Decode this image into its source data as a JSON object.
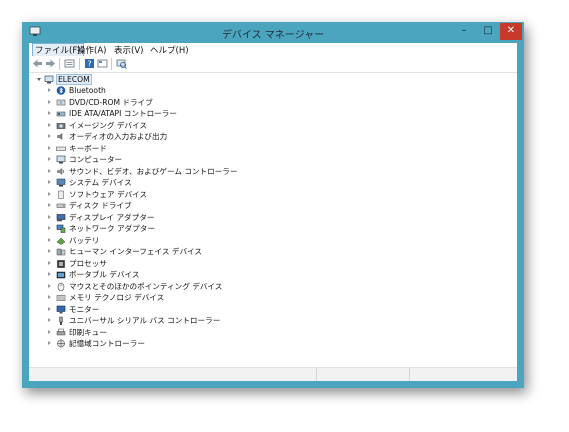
{
  "window": {
    "title": "デバイス マネージャー",
    "minimize_glyph": "–",
    "maximize_glyph": "□",
    "close_glyph": "✕"
  },
  "menu": [
    {
      "label": "ファイル(F)",
      "active": true
    },
    {
      "label": "操作(A)"
    },
    {
      "label": "表示(V)"
    },
    {
      "label": "ヘルプ(H)"
    }
  ],
  "toolbar": {
    "icons": [
      "back-arrow-icon",
      "forward-arrow-icon",
      "properties-icon",
      "help-icon",
      "view-icon",
      "scan-hardware-icon"
    ]
  },
  "tree": {
    "root": {
      "label": "ELECOM",
      "icon": "computer-icon"
    },
    "items": [
      {
        "label": "Bluetooth",
        "icon": "bluetooth-icon"
      },
      {
        "label": "DVD/CD-ROM ドライブ",
        "icon": "dvd-drive-icon"
      },
      {
        "label": "IDE ATA/ATAPI コントローラー",
        "icon": "ide-controller-icon"
      },
      {
        "label": "イメージング デバイス",
        "icon": "imaging-device-icon"
      },
      {
        "label": "オーディオの入力および出力",
        "icon": "audio-icon"
      },
      {
        "label": "キーボード",
        "icon": "keyboard-icon"
      },
      {
        "label": "コンピューター",
        "icon": "computer-icon"
      },
      {
        "label": "サウンド、ビデオ、およびゲーム コントローラー",
        "icon": "sound-icon"
      },
      {
        "label": "システム デバイス",
        "icon": "system-device-icon"
      },
      {
        "label": "ソフトウェア デバイス",
        "icon": "software-device-icon"
      },
      {
        "label": "ディスク ドライブ",
        "icon": "disk-drive-icon"
      },
      {
        "label": "ディスプレイ アダプター",
        "icon": "display-adapter-icon"
      },
      {
        "label": "ネットワーク アダプター",
        "icon": "network-adapter-icon"
      },
      {
        "label": "バッテリ",
        "icon": "battery-icon"
      },
      {
        "label": "ヒューマン インターフェイス デバイス",
        "icon": "hid-icon"
      },
      {
        "label": "プロセッサ",
        "icon": "processor-icon"
      },
      {
        "label": "ポータブル デバイス",
        "icon": "portable-device-icon"
      },
      {
        "label": "マウスとそのほかのポインティング デバイス",
        "icon": "mouse-icon"
      },
      {
        "label": "メモリ テクノロジ デバイス",
        "icon": "memory-device-icon"
      },
      {
        "label": "モニター",
        "icon": "monitor-icon"
      },
      {
        "label": "ユニバーサル シリアル バス コントローラー",
        "icon": "usb-controller-icon"
      },
      {
        "label": "印刷キュー",
        "icon": "printer-icon"
      },
      {
        "label": "記憶域コントローラー",
        "icon": "storage-controller-icon"
      }
    ]
  },
  "colors": {
    "frame": "#4ba5be",
    "close_button": "#c7392a",
    "selection": "#dcebf7"
  }
}
